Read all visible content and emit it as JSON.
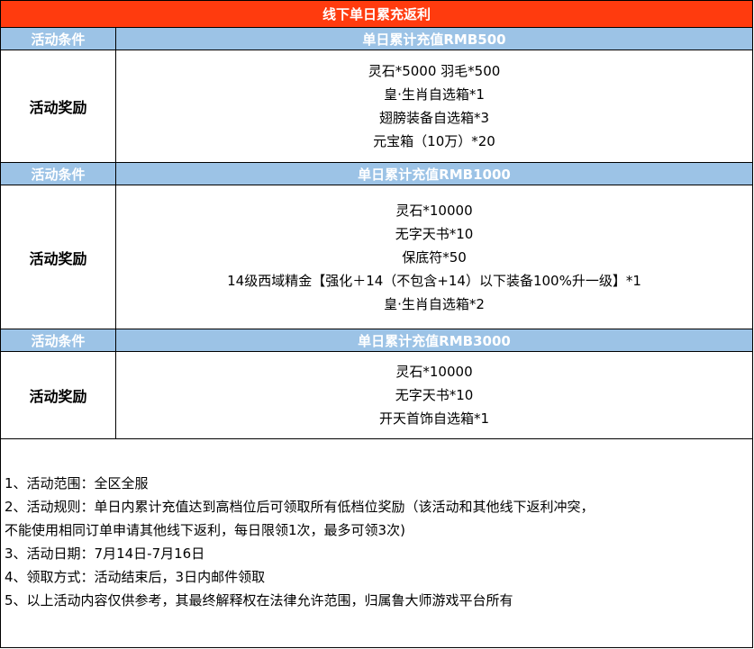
{
  "title": "线下单日累充返利",
  "tiers": [
    {
      "condition_label": "活动条件",
      "condition_value": "单日累计充值RMB500",
      "reward_label": "活动奖励",
      "rewards": [
        "灵石*5000 羽毛*500",
        "皇·生肖自选箱*1",
        "翅膀装备自选箱*3",
        "元宝箱（10万）*20"
      ]
    },
    {
      "condition_label": "活动条件",
      "condition_value": "单日累计充值RMB1000",
      "reward_label": "活动奖励",
      "rewards": [
        "灵石*10000",
        "无字天书*10",
        "保底符*50",
        "14级西域精金【强化＋14（不包含+14）以下装备100%升一级】*1",
        "皇·生肖自选箱*2"
      ]
    },
    {
      "condition_label": "活动条件",
      "condition_value": "单日累计充值RMB3000",
      "reward_label": "活动奖励",
      "rewards": [
        "灵石*10000",
        "无字天书*10",
        "开天首饰自选箱*1"
      ]
    }
  ],
  "notes": [
    "1、活动范围：全区全服",
    "2、活动规则：单日内累计充值达到高档位后可领取所有低档位奖励（该活动和其他线下返利冲突，",
    "不能使用相同订单申请其他线下返利，每日限领1次，最多可领3次)",
    "3、活动日期：7月14日-7月16日",
    "4、领取方式：活动结束后，3日内邮件领取",
    "5、以上活动内容仅供参考，其最终解释权在法律允许范围，归属鲁大师游戏平台所有"
  ],
  "colors": {
    "title_bg": "#ff3b0e",
    "condition_bg": "#9cc3e6",
    "text_light": "#ffffff"
  }
}
